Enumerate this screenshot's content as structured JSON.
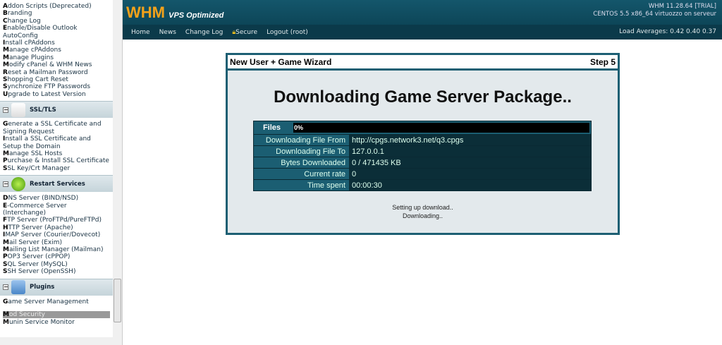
{
  "sidebar": {
    "top_items": [
      "Addon Scripts (Deprecated)",
      "Branding",
      "Change Log",
      "Enable/Disable Outlook AutoConfig",
      "Install cPAddons",
      "Manage cPAddons",
      "Manage Plugins",
      "Modify cPanel & WHM News",
      "Reset a Mailman Password",
      "Shopping Cart Reset",
      "Synchronize FTP Passwords",
      "Upgrade to Latest Version"
    ],
    "sections": [
      {
        "title": "SSL/TLS",
        "icon": "certificate-icon",
        "items": [
          "Generate a SSL Certificate and Signing Request",
          "Install a SSL Certificate and Setup the Domain",
          "Manage SSL Hosts",
          "Purchase & Install SSL Certificate",
          "SSL Key/Crt Manager"
        ]
      },
      {
        "title": "Restart Services",
        "icon": "restart-icon",
        "items": [
          "DNS Server (BIND/NSD)",
          "E-Commerce Server (Interchange)",
          "FTP Server (ProFTPd/PureFTPd)",
          "HTTP Server (Apache)",
          "IMAP Server (Courier/Dovecot)",
          "Mail Server (Exim)",
          "Mailing List Manager (Mailman)",
          "POP3 Server (cPPOP)",
          "SQL Server (MySQL)",
          "SSH Server (OpenSSH)"
        ]
      },
      {
        "title": "Plugins",
        "icon": "puzzle-icon",
        "items": [
          "Game Server Management",
          "Mod Security",
          "Munin Service Monitor"
        ],
        "selected": "Mod Security"
      }
    ]
  },
  "header": {
    "logo": "WHM",
    "logo_sub": "VPS Optimized",
    "version": "WHM 11.28.64 [TRIAL]",
    "os": "CENTOS 5.5 x86_64 virtuozzo on serveur"
  },
  "nav": {
    "home": "Home",
    "news": "News",
    "changelog": "Change Log",
    "secure": "Secure",
    "logout": "Logout (root)",
    "load": "Load Averages: 0.42 0.40 0.37"
  },
  "wizard": {
    "title": "New User + Game Wizard",
    "step": "Step 5",
    "heading": "Downloading Game Server Package..",
    "files_label": "Files",
    "progress_text": "0%",
    "progress": 0,
    "rows": [
      [
        "Downloading File From",
        "http://cpgs.network3.net/q3.cpgs"
      ],
      [
        "Downloading File To",
        "127.0.0.1"
      ],
      [
        "Bytes Downloaded",
        "0 / 471435 KB"
      ],
      [
        "Current rate",
        "0"
      ],
      [
        "Time spent",
        "00:00:30"
      ]
    ],
    "status": [
      "Setting up download..",
      "Downloading.."
    ]
  }
}
